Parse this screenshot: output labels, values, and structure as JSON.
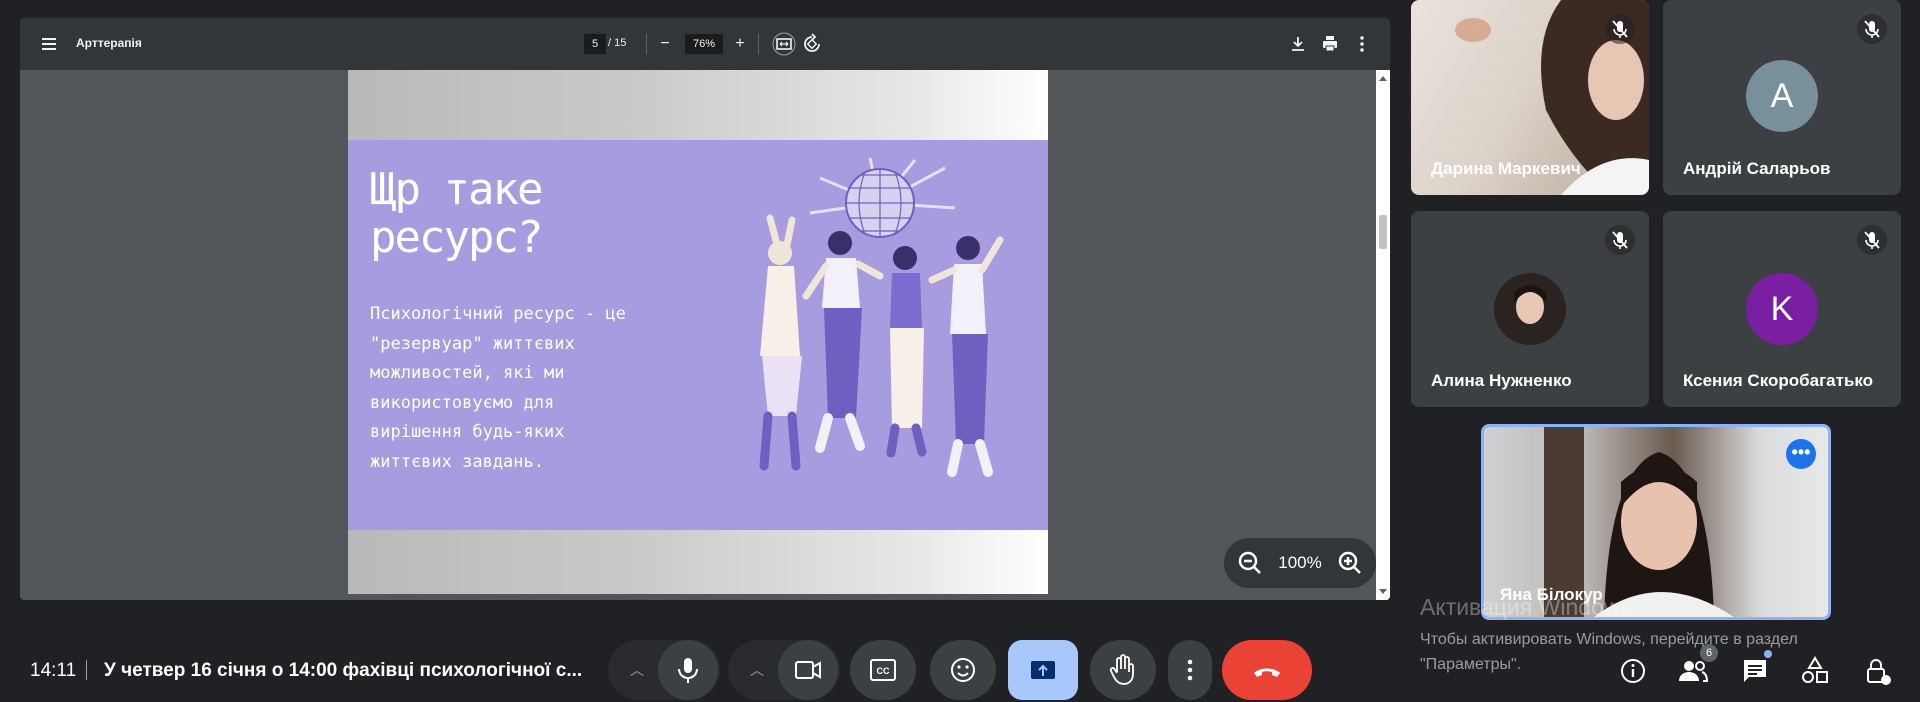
{
  "pdf_viewer": {
    "title": "Арттерапія",
    "current_page": "5",
    "total_pages": "/ 15",
    "zoom": "76%"
  },
  "slide": {
    "title_line1": "Щр таке",
    "title_line2": "ресурс?",
    "body_lines": [
      "Психологічний ресурс - це",
      "\"резервуар\" життєвих",
      "можливостей, які ми",
      "використовуємо для",
      "вирішення будь-яких",
      "життєвих завдань."
    ]
  },
  "zoom_control": {
    "value": "100%"
  },
  "participants": [
    {
      "name": "Дарина Маркевич"
    },
    {
      "name": "Андрій Саларьов",
      "initial": "A",
      "avatar_color": "#78909c"
    },
    {
      "name": "Алина Нужненко"
    },
    {
      "name": "Ксения Скоробагатько",
      "initial": "K",
      "avatar_color": "#7b1fa2"
    },
    {
      "name": "Яна Білокур"
    }
  ],
  "windows_watermark": {
    "title": "Активация Windows",
    "line": "Чтобы активировать Windows, перейдите в раздел \"Параметры\"."
  },
  "bottom_bar": {
    "time": "14:11",
    "meeting_title": "У четвер 16 січня о 14:00 фахівці психологічної с...",
    "participants_count": "6"
  },
  "colors": {
    "slide_bg": "#a89ce0",
    "leave_button": "#ea4335",
    "present_button": "#a8c7fa",
    "active_speaker_border": "#8ab4f8"
  }
}
